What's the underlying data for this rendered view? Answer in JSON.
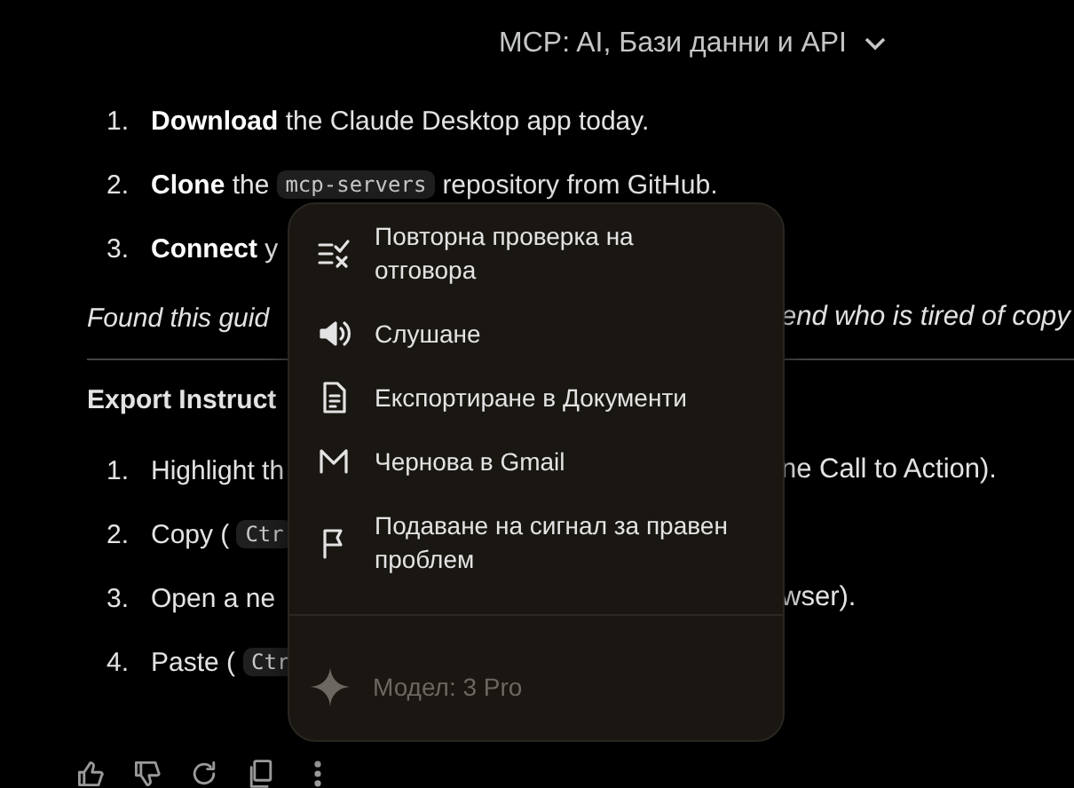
{
  "header": {
    "title": "MCP: AI, Бази данни и API"
  },
  "steps": [
    {
      "number": "1.",
      "segments": [
        {
          "kind": "text",
          "text": "**Download** the Claude Desktop app today."
        }
      ]
    },
    {
      "number": "2.",
      "segments": [
        {
          "kind": "text",
          "text": "**Clone** the"
        },
        {
          "kind": "code",
          "text": "mcp-servers"
        },
        {
          "kind": "text",
          "text": "repository from GitHub."
        }
      ]
    },
    {
      "number": "3.",
      "segments": [
        {
          "kind": "text",
          "text": "**Connect** y"
        }
      ]
    }
  ],
  "note": {
    "text": "Found this guid",
    "right_text": "end who is tired of copy"
  },
  "export": {
    "heading": "Export Instruct",
    "steps": [
      {
        "number": "1.",
        "segments": [
          {
            "kind": "text",
            "text": "Highlight th"
          }
        ],
        "right_text": "ne Call to Action)."
      },
      {
        "number": "2.",
        "segments": [
          {
            "kind": "text",
            "text": "Copy ("
          },
          {
            "kind": "code",
            "text": "Ctr"
          }
        ]
      },
      {
        "number": "3.",
        "segments": [
          {
            "kind": "text",
            "text": "Open a ne"
          }
        ],
        "right_text": "wser)."
      },
      {
        "number": "4.",
        "segments": [
          {
            "kind": "text",
            "text": "Paste ("
          },
          {
            "kind": "code",
            "text": "Ctr"
          }
        ]
      }
    ]
  },
  "menu": {
    "items": [
      {
        "kind": "check",
        "label": "Повторна проверка на отговора"
      },
      {
        "kind": "speaker",
        "label": "Слушане"
      },
      {
        "kind": "document",
        "label": "Експортиране в Документи"
      },
      {
        "kind": "mail",
        "label": "Чернова в Gmail"
      },
      {
        "kind": "flag",
        "label": "Подаване на сигнал за правен проблем"
      }
    ],
    "footer": {
      "label": "Модел: 3 Pro",
      "disabled": true
    }
  },
  "actions": [
    {
      "kind": "thumbs-up"
    },
    {
      "kind": "thumbs-down"
    },
    {
      "kind": "refresh"
    },
    {
      "kind": "copy"
    },
    {
      "kind": "more"
    }
  ]
}
